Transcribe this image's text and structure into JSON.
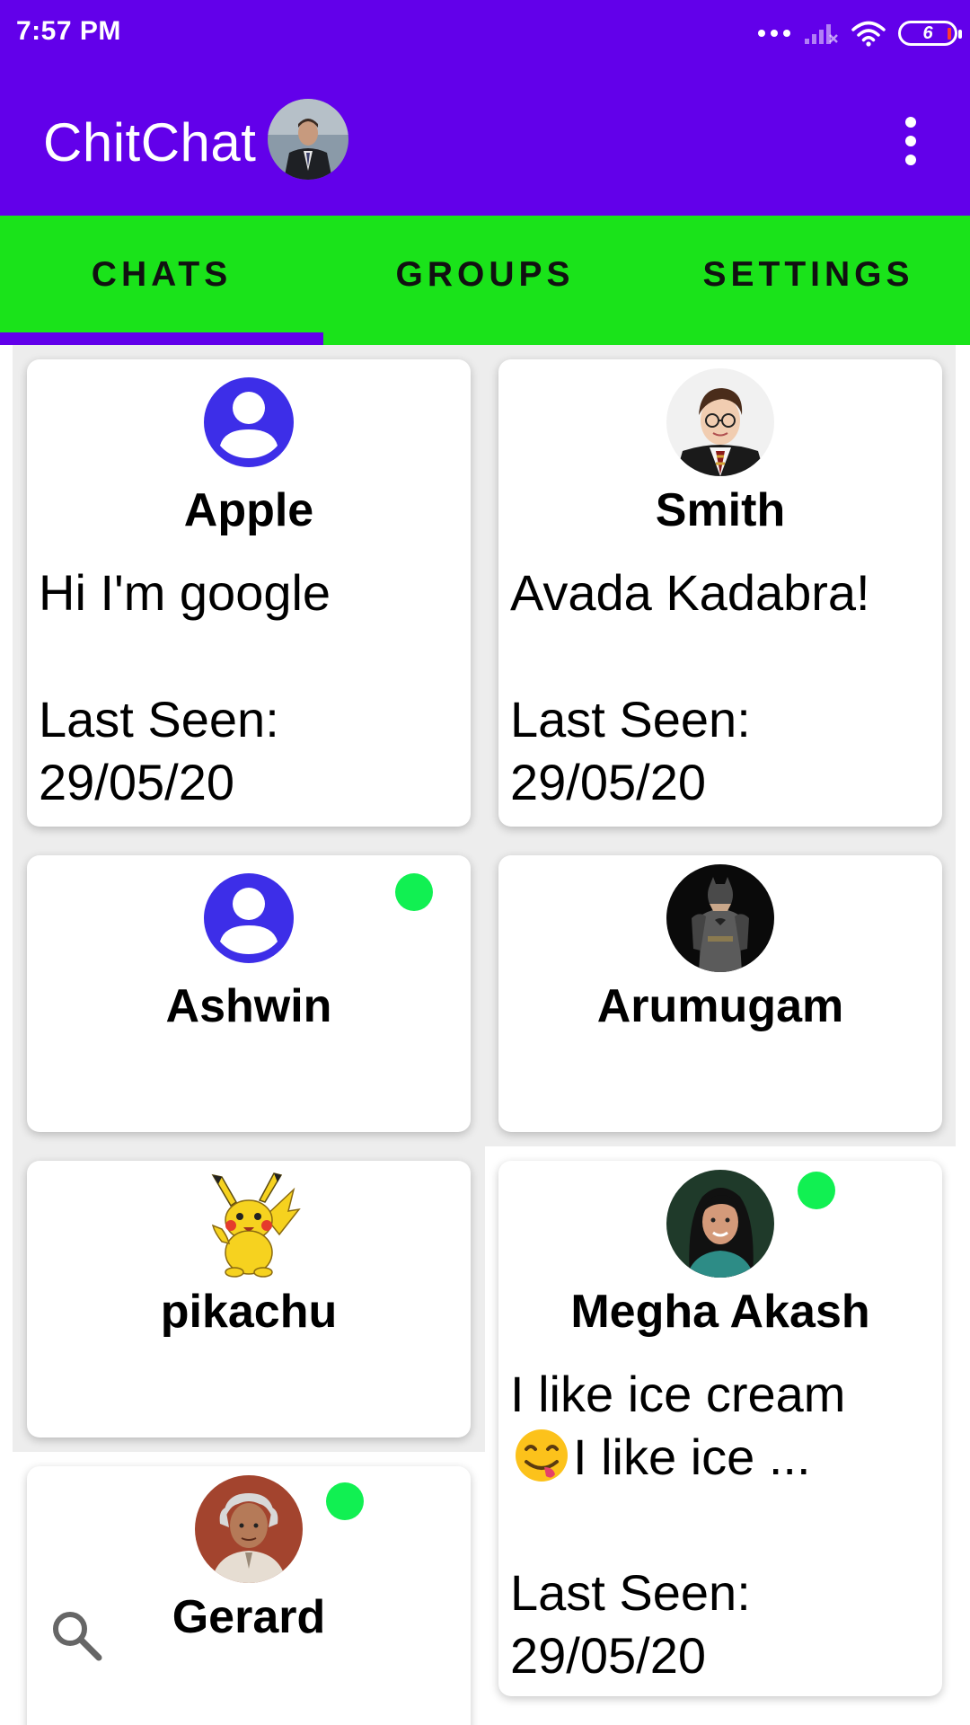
{
  "status_bar": {
    "time": "7:57 PM",
    "battery": "6",
    "icons": [
      "more-dots-icon",
      "no-signal-icon",
      "wifi-icon",
      "battery-icon"
    ]
  },
  "toolbar": {
    "title": "ChitChat",
    "avatar_icon": "profile-photo",
    "menu_icon": "more-vertical-icon"
  },
  "tabs": [
    {
      "label": "CHATS",
      "selected": true
    },
    {
      "label": "GROUPS",
      "selected": false
    },
    {
      "label": "SETTINGS",
      "selected": false
    }
  ],
  "colors": {
    "primary": "#6200ea",
    "tab_bar": "#1ae31a",
    "online": "#11f052",
    "default_avatar": "#3d2ee8"
  },
  "chats": [
    {
      "name": "Apple",
      "message": "Hi I'm google",
      "last_seen": "Last Seen: 29/05/20",
      "avatar": "default-person-icon",
      "online": false
    },
    {
      "name": "Smith",
      "message": "Avada Kadabra!",
      "last_seen": "Last Seen: 29/05/20",
      "avatar": "wizard-photo",
      "online": false
    },
    {
      "name": "Ashwin",
      "message": "",
      "last_seen": "",
      "avatar": "default-person-icon",
      "online": true
    },
    {
      "name": "Arumugam",
      "message": "",
      "last_seen": "",
      "avatar": "batman-photo",
      "online": false
    },
    {
      "name": "pikachu",
      "message": "",
      "last_seen": "",
      "avatar": "pikachu-image",
      "online": false
    },
    {
      "name": "Megha Akash",
      "message_line1": "I like ice cream",
      "message_line2": "I like ice ...",
      "message_emoji": "face-savoring-food-emoji",
      "last_seen": "Last Seen: 29/05/20",
      "avatar": "woman-photo",
      "online": true
    },
    {
      "name": "Gerard",
      "message": "",
      "last_seen": "",
      "avatar": "man-photo",
      "online": true
    }
  ],
  "fab": {
    "icon": "search-icon"
  }
}
